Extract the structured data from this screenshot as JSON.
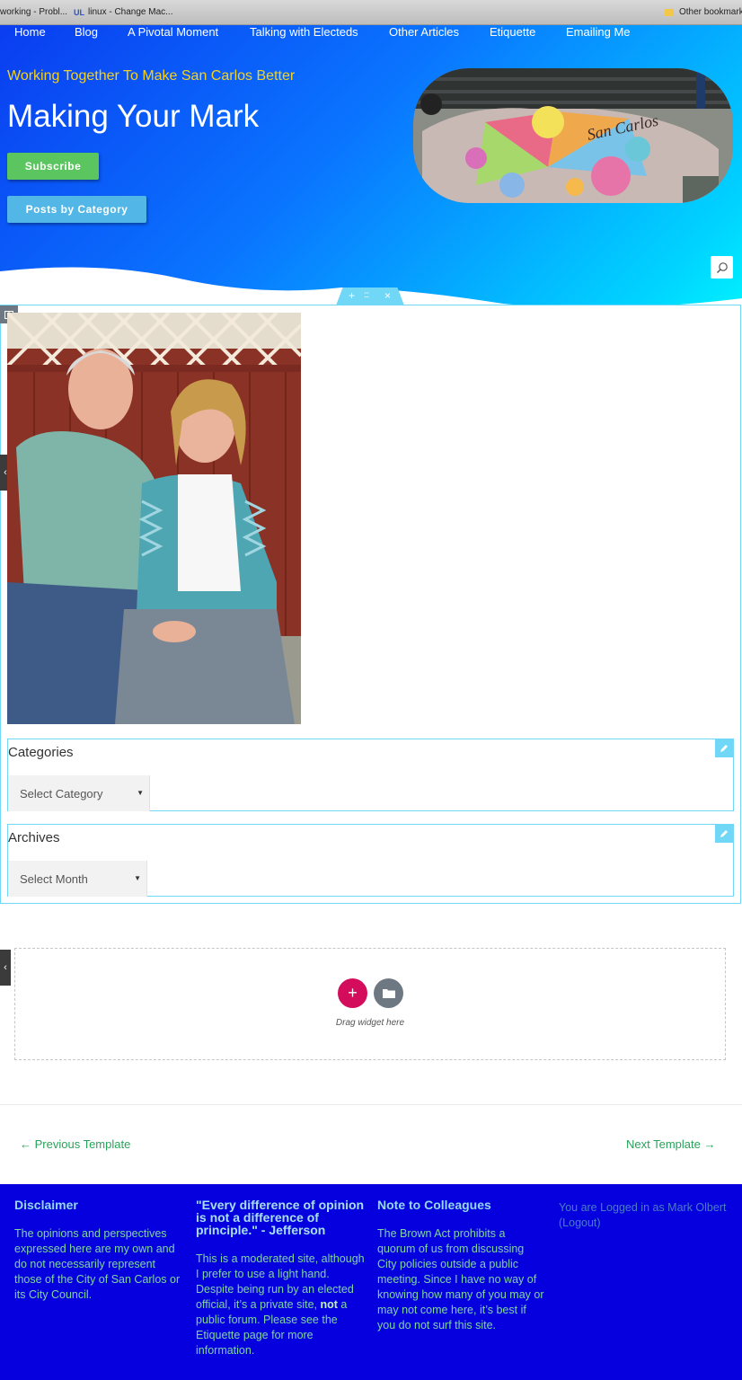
{
  "bookmarks": {
    "items": [
      "working - Probl...",
      "linux - Change Mac..."
    ],
    "ul_icon": "UL",
    "other": "Other bookmarks"
  },
  "nav": [
    "Home",
    "Blog",
    "A Pivotal Moment",
    "Talking with Electeds",
    "Other Articles",
    "Etiquette",
    "Emailing Me"
  ],
  "hero": {
    "tagline": "Working Together To Make San Carlos Better",
    "title": "Making Your Mark",
    "subscribe": "Subscribe",
    "posts_by_category": "Posts by Category"
  },
  "editor": {
    "add": "+",
    "move": ":::",
    "close": "×"
  },
  "widgets": {
    "categories": {
      "title": "Categories",
      "select": "Select Category"
    },
    "archives": {
      "title": "Archives",
      "select": "Select Month"
    }
  },
  "dropzone": {
    "add": "+",
    "text": "Drag widget here"
  },
  "templates": {
    "prev": "← Previous Template",
    "next": "Next Template →"
  },
  "footer": {
    "disclaimer": {
      "heading": "Disclaimer",
      "text": "The opinions and perspectives expressed here are my own and do not necessarily represent those of the City of San Carlos or its City Council."
    },
    "quote": {
      "heading": "\"Every difference of opinion is not a difference of principle.\" - Jefferson",
      "text_a": "This is a moderated site, although I prefer to use a light hand. Despite being run by an elected official, it’s a private site, ",
      "text_bold": "not",
      "text_b": " a public forum. Please see the Etiquette page for more information."
    },
    "colleagues": {
      "heading": "Note to Colleagues",
      "text": "The Brown Act prohibits a quorum of us from discussing City policies outside a public meeting. Since I have no way of knowing how many of you may or may not come here, it’s best if you do not surf this site."
    },
    "login": "You are Logged in as Mark Olbert (Logout)"
  },
  "colors": {
    "hero_start": "#0a3df0",
    "hero_end": "#00f0ff",
    "tagline": "#f5d122",
    "subscribe": "#5bc65f",
    "category_btn": "#52b7e6",
    "footer_bg": "#0700de",
    "link": "#28a35a"
  }
}
